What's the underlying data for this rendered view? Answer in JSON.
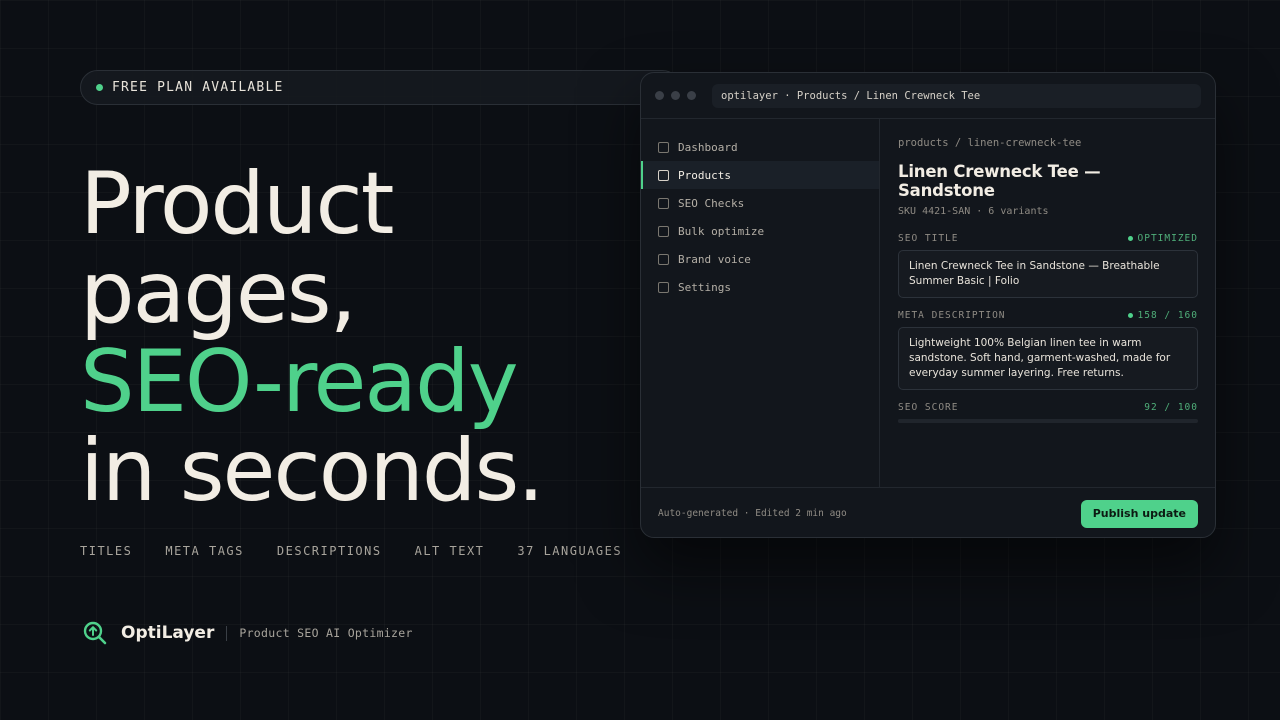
{
  "badge": {
    "text": "FREE PLAN AVAILABLE"
  },
  "headline": {
    "line1": "Product",
    "line2": "pages,",
    "line3": "SEO-ready",
    "line4": "in seconds."
  },
  "features": [
    "TITLES",
    "META TAGS",
    "DESCRIPTIONS",
    "ALT TEXT",
    "37 LANGUAGES"
  ],
  "brand": {
    "name": "OptiLayer",
    "tagline": "Product SEO AI Optimizer"
  },
  "window": {
    "url": "optilayer · Products / Linen Crewneck Tee",
    "nav": [
      {
        "label": "Dashboard",
        "active": false
      },
      {
        "label": "Products",
        "active": true
      },
      {
        "label": "SEO Checks",
        "active": false
      },
      {
        "label": "Bulk optimize",
        "active": false
      },
      {
        "label": "Brand voice",
        "active": false
      },
      {
        "label": "Settings",
        "active": false
      }
    ],
    "breadcrumb": "products / linen-crewneck-tee",
    "product_title": "Linen Crewneck Tee — Sandstone",
    "sku": "SKU 4421-SAN · 6 variants",
    "seo_title": {
      "label": "SEO TITLE",
      "status": "OPTIMIZED",
      "value": "Linen Crewneck Tee in Sandstone — Breathable Summer Basic | Folio"
    },
    "meta_description": {
      "label": "META DESCRIPTION",
      "status": "158 / 160",
      "value": "Lightweight 100% Belgian linen tee in warm sandstone. Soft hand, garment-washed, made for everyday summer layering. Free returns."
    },
    "seo_score": {
      "label": "SEO SCORE",
      "text": "92 / 100",
      "value": 92,
      "max": 100
    },
    "footer_meta": "Auto-generated · Edited 2 min ago",
    "publish_label": "Publish update"
  },
  "colors": {
    "accent": "#4fd18b",
    "background": "#0c0f14",
    "text": "#f2ede4"
  }
}
